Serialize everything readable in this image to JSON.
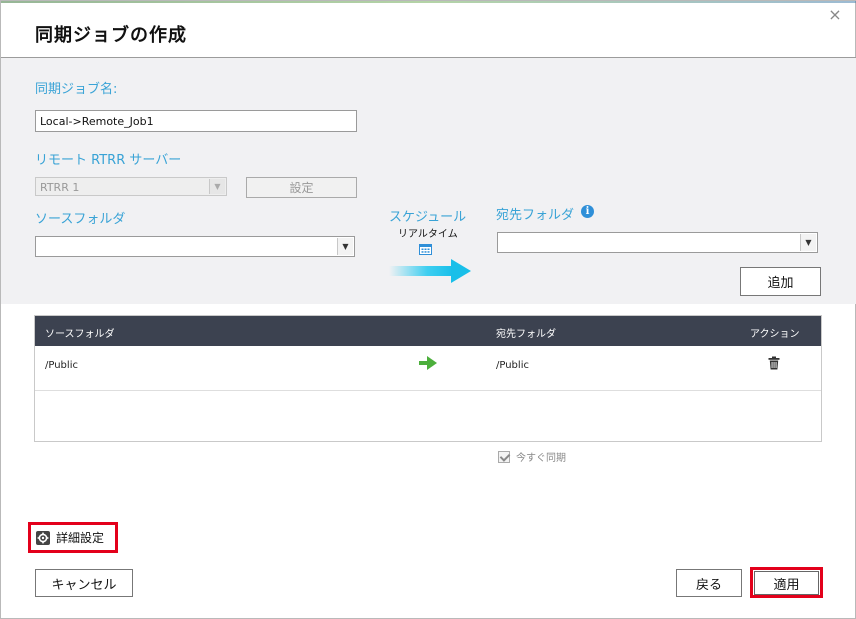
{
  "dialog": {
    "title": "同期ジョブの作成",
    "close_glyph": "×"
  },
  "form": {
    "job_name_label": "同期ジョブ名:",
    "job_name_value": "Local->Remote_Job1",
    "remote_server_label": "リモート RTRR サーバー",
    "remote_server_value": "RTRR 1",
    "settings_button": "設定",
    "source_folder_label": "ソースフォルダ",
    "source_folder_value": "",
    "schedule_label": "スケジュール",
    "schedule_mode": "リアルタイム",
    "dest_folder_label": "宛先フォルダ",
    "dest_folder_value": "",
    "add_button": "追加"
  },
  "table": {
    "headers": {
      "source": "ソースフォルダ",
      "dest": "宛先フォルダ",
      "action": "アクション"
    },
    "rows": [
      {
        "source": "/Public",
        "dest": "/Public"
      }
    ]
  },
  "sync_now_label": "今すぐ同期",
  "footer": {
    "advanced_settings": "詳細設定",
    "cancel": "キャンセル",
    "back": "戻る",
    "apply": "適用"
  },
  "colors": {
    "accent_blue": "#39a3d6",
    "table_header": "#3c4250",
    "highlight_red": "#e3001b",
    "arrow_green": "#4caf3c",
    "arrow_cyan": "#1ec8f0"
  },
  "icons": {
    "close": "close-icon",
    "calendar": "calendar-icon",
    "sync_arrow": "arrow-right-icon",
    "info": "info-icon",
    "row_arrow": "green-arrow-icon",
    "delete": "trash-icon",
    "gear": "gear-icon"
  }
}
